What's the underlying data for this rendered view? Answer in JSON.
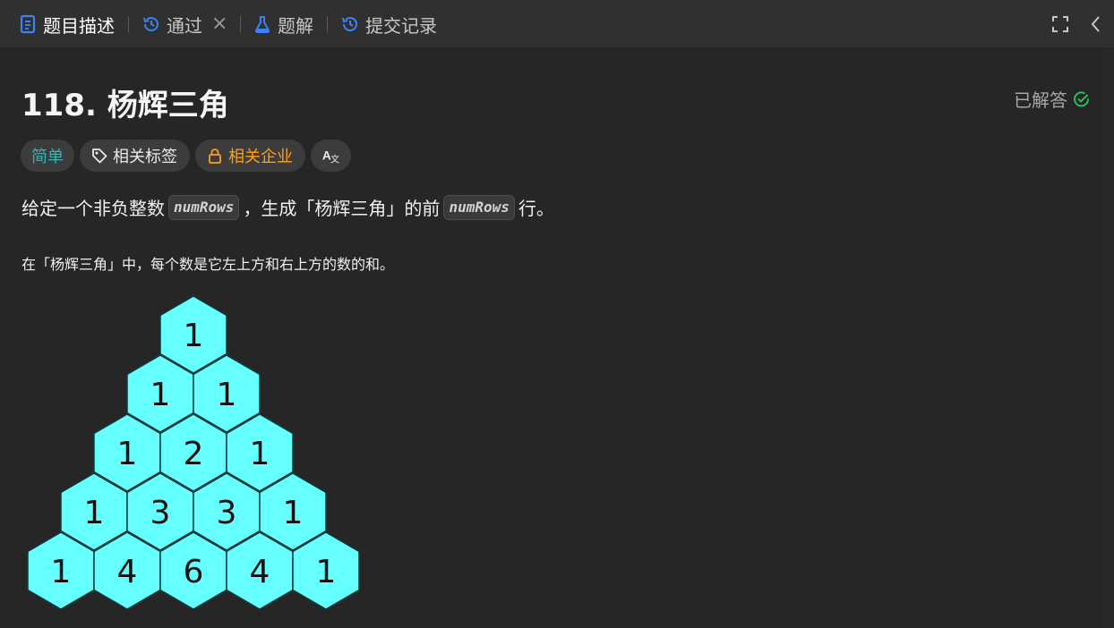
{
  "tabs": [
    {
      "label": "题目描述",
      "icon": "document-icon",
      "active": true
    },
    {
      "label": "通过",
      "icon": "history-icon",
      "closable": true
    },
    {
      "label": "题解",
      "icon": "flask-icon"
    },
    {
      "label": "提交记录",
      "icon": "history-icon"
    }
  ],
  "toolbar": {
    "fullscreen_icon": "fullscreen-icon",
    "collapse_icon": "chevron-left-icon"
  },
  "problem": {
    "title": "118. 杨辉三角",
    "status": "已解答",
    "status_icon": "check-circle-icon",
    "tags": [
      {
        "label": "简单",
        "color": "#2cbbb4"
      },
      {
        "label": "相关标签",
        "icon": "tag-icon",
        "color": "#eaeaea"
      },
      {
        "label": "相关企业",
        "icon": "lock-icon",
        "color": "#ffa116"
      },
      {
        "label": "",
        "icon": "translate-icon",
        "color": "#eaeaea"
      }
    ],
    "description": {
      "part1": "给定一个非负整数",
      "code1": "numRows",
      "part2": "，生成「杨辉三角」的前",
      "code2": "numRows",
      "part3": "行。"
    },
    "description2": "在「杨辉三角」中，每个数是它左上方和右上方的数的和。"
  },
  "pascal": {
    "rows": [
      [
        1
      ],
      [
        1,
        1
      ],
      [
        1,
        2,
        1
      ],
      [
        1,
        3,
        3,
        1
      ],
      [
        1,
        4,
        6,
        4,
        1
      ]
    ],
    "fill": "#66ffff",
    "stroke": "#0f3b3b",
    "text_color": "#111111"
  },
  "colors": {
    "accent_blue": "#3b82f6",
    "success": "#2cbb5d",
    "easy": "#2cbbb4",
    "medium_orange": "#ffa116"
  }
}
